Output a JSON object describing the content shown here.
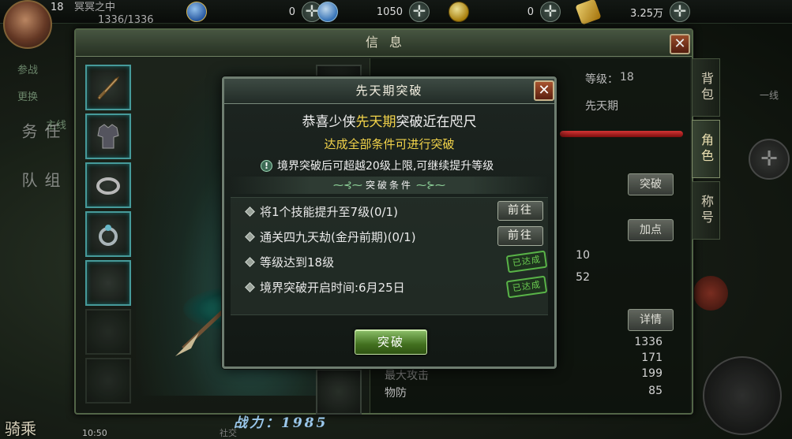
{
  "hud": {
    "level": "18",
    "player_name": "冥冥之中",
    "hp_text": "1336/1336",
    "currencies": [
      {
        "name": "copper-coin-icon",
        "value": "0",
        "color": "#4a8ad8"
      },
      {
        "name": "silver-coin-icon",
        "value": "1050",
        "color": "#5aa8e8"
      },
      {
        "name": "gold-coin-icon",
        "value": "0",
        "color": "#e0c030"
      },
      {
        "name": "gold-ingot-icon",
        "value": "3.25万",
        "color": "#e8b820"
      }
    ],
    "left_labels": [
      "参战",
      "更换",
      "主线",
      "任务",
      "组队"
    ],
    "ride_label": "骑乘",
    "clock": "10:50",
    "social": "社交",
    "line_label": "一线"
  },
  "info_window": {
    "title": "信息",
    "character_name": "冥冥",
    "power_label": "战力：1985",
    "level_label": "等级：",
    "level_value": "18",
    "realm": "先天期",
    "buttons": {
      "breakthrough": "突破",
      "add_points": "加点",
      "details": "详情"
    },
    "stats": [
      {
        "label": "",
        "value": "10"
      },
      {
        "label": "",
        "value": "52"
      },
      {
        "label": "",
        "value": "1336"
      },
      {
        "label": "",
        "value": "171"
      },
      {
        "label": "最大攻击",
        "value": "199"
      },
      {
        "label": "物防",
        "value": "85"
      }
    ],
    "side_tabs": [
      {
        "label": "背包",
        "active": false
      },
      {
        "label": "角色",
        "active": true
      },
      {
        "label": "称号",
        "active": false
      }
    ]
  },
  "dialog": {
    "title": "先天期突破",
    "line1_prefix": "恭喜少侠",
    "line1_highlight": "先天期",
    "line1_suffix": "突破近在咫尺",
    "line2": "达成全部条件可进行突破",
    "tip": "境界突破后可超越20级上限,可继续提升等级",
    "conditions_header": "突破条件",
    "conditions": [
      {
        "text": "将1个技能提升至7级(0/1)",
        "status": "go",
        "button": "前往"
      },
      {
        "text": "通关四九天劫(金丹前期)(0/1)",
        "status": "go",
        "button": "前往"
      },
      {
        "text": "等级达到18级",
        "status": "done",
        "stamp": "已达成"
      },
      {
        "text": "境界突破开启时间:6月25日",
        "status": "done",
        "stamp": "已达成"
      }
    ],
    "action_button": "突破"
  },
  "colors": {
    "highlight": "#f2d34a",
    "done_green": "#6ccf52",
    "slot_teal": "#4ca8a8"
  }
}
